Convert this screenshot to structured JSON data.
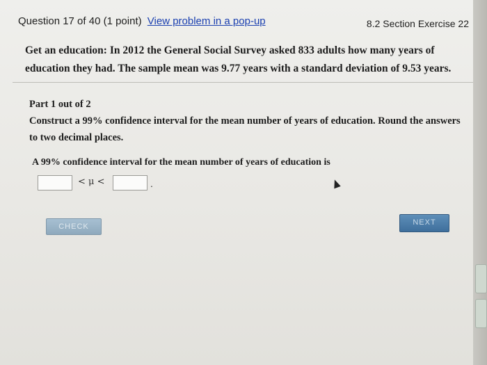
{
  "header": {
    "question": "Question 17 of 40 (1 point)",
    "popup_link": "View problem in a pop-up",
    "section_ref": "8.2 Section Exercise 22"
  },
  "problem": {
    "text": "Get an education: In 2012 the General Social Survey asked 833 adults how many years of education they had. The sample mean was 9.77 years with a standard deviation of 9.53 years."
  },
  "part": {
    "label": "Part 1 out of 2",
    "instruction": "Construct a 99% confidence interval for the mean number of years of education. Round the answers to two decimal places."
  },
  "answer": {
    "label": "A 99% confidence interval for the mean number of years of education is",
    "lower_value": "",
    "upper_value": "",
    "mu_expression": "< μ <",
    "trailing": "."
  },
  "buttons": {
    "check": "CHECK",
    "next": "NEXT"
  },
  "colors": {
    "link": "#1a3fb0",
    "check_button": "#9fb8cb",
    "next_button": "#4a7aa6"
  }
}
